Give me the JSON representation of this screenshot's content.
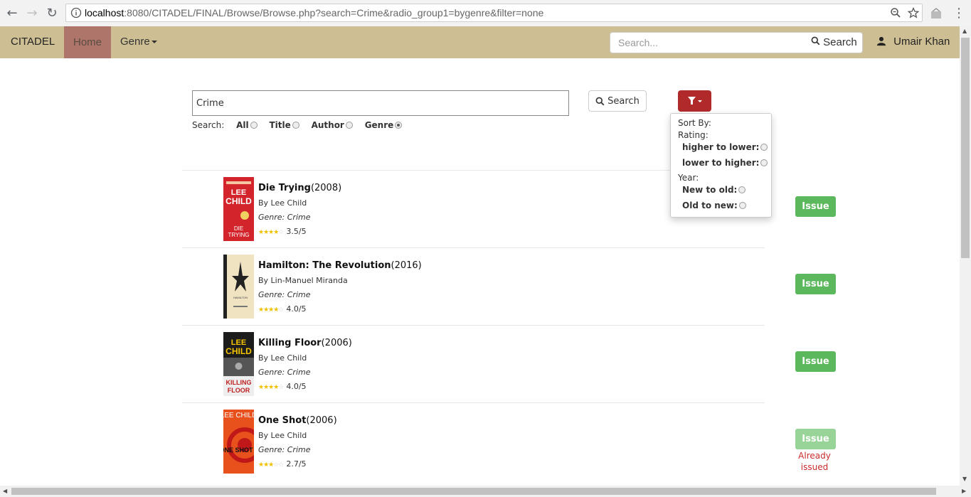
{
  "browser": {
    "url_host": "localhost",
    "url_rest": ":8080/CITADEL/FINAL/Browse/Browse.php?search=Crime&radio_group1=bygenre&filter=none"
  },
  "navbar": {
    "brand": "CITADEL",
    "home": "Home",
    "genre": "Genre",
    "search_placeholder": "Search...",
    "search_button": "Search",
    "user_name": "Umair Khan",
    "bg_color": "#cdbf93",
    "active_color": "#ae766a"
  },
  "search_form": {
    "query": "Crime",
    "button": "Search",
    "search_label": "Search:",
    "options": [
      "All",
      "Title",
      "Author",
      "Genre"
    ],
    "selected": "Genre"
  },
  "filter_menu": {
    "sort_by": "Sort By:",
    "rating_label": "Rating:",
    "rating_high_low": "higher to lower:",
    "rating_low_high": "lower to higher:",
    "year_label": "Year:",
    "year_new_old": "New to old:",
    "year_old_new": "Old to new:"
  },
  "results": [
    {
      "title": "Die Trying",
      "year": "(2008)",
      "author": "By Lee Child",
      "genre": "Genre: Crime",
      "rating": 3.5,
      "rating_text": "3.5/5",
      "button": "Issue",
      "issued": false,
      "cover_color": "#d4242b"
    },
    {
      "title": "Hamilton: The Revolution",
      "year": "(2016)",
      "author": "By Lin-Manuel Miranda",
      "genre": "Genre: Crime",
      "rating": 4.0,
      "rating_text": "4.0/5",
      "button": "Issue",
      "issued": false,
      "cover_color": "#efe3c2"
    },
    {
      "title": "Killing Floor",
      "year": "(2006)",
      "author": "By Lee Child",
      "genre": "Genre: Crime",
      "rating": 4.0,
      "rating_text": "4.0/5",
      "button": "Issue",
      "issued": false,
      "cover_color": "#1c1c1c"
    },
    {
      "title": "One Shot",
      "year": "(2006)",
      "author": "By Lee Child",
      "genre": "Genre: Crime",
      "rating": 2.7,
      "rating_text": "2.7/5",
      "button": "Issue",
      "issued": true,
      "issued_note": "Already issued",
      "cover_color": "#e8501c"
    }
  ]
}
